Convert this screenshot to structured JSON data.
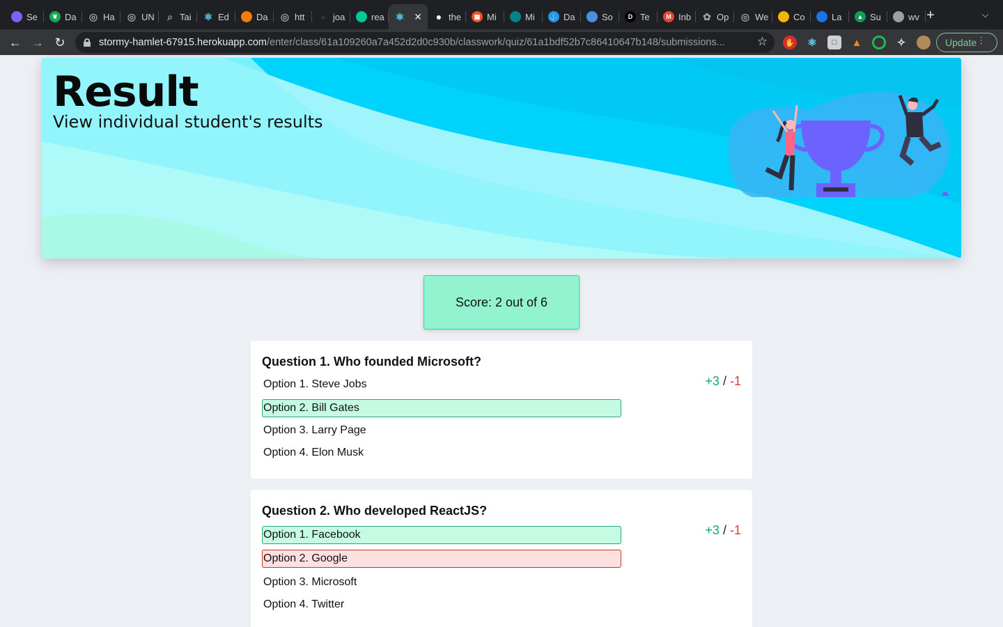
{
  "browser": {
    "tabs": [
      {
        "label": "Se",
        "icon": "circle-app-icon",
        "color": "#7b61ff"
      },
      {
        "label": "Da",
        "icon": "leaf-icon",
        "color": "#13aa52"
      },
      {
        "label": "Ha",
        "icon": "globe-icon",
        "color": "#9aa0a6"
      },
      {
        "label": "UN",
        "icon": "globe-icon",
        "color": "#9aa0a6"
      },
      {
        "label": "Tai",
        "icon": "search-icon",
        "color": "#9aa0a6"
      },
      {
        "label": "Ed",
        "icon": "react-icon",
        "color": "#61dafb"
      },
      {
        "label": "Da",
        "icon": "bracket-icon",
        "color": "#f57c00"
      },
      {
        "label": "htt",
        "icon": "globe-icon",
        "color": "#9aa0a6"
      },
      {
        "label": "joa",
        "icon": "github-icon",
        "color": "#333333"
      },
      {
        "label": "rea",
        "icon": "square-app-icon",
        "color": "#00c896"
      },
      {
        "label": "",
        "icon": "react-icon",
        "color": "#61dafb",
        "active": true
      },
      {
        "label": "the",
        "icon": "github-icon",
        "color": "#ffffff"
      },
      {
        "label": "Mi",
        "icon": "microsoft-icon",
        "color": "#f25022"
      },
      {
        "label": "Mi",
        "icon": "forms-icon",
        "color": "#038387"
      },
      {
        "label": "Da",
        "icon": "docker-icon",
        "color": "#2496ed"
      },
      {
        "label": "So",
        "icon": "arc-icon",
        "color": "#4a90e2"
      },
      {
        "label": "Te",
        "icon": "dev-icon",
        "color": "#000000"
      },
      {
        "label": "Inb",
        "icon": "gmail-icon",
        "color": "#ea4335"
      },
      {
        "label": "Op",
        "icon": "openai-icon",
        "color": "#9aa0a6"
      },
      {
        "label": "We",
        "icon": "globe-icon",
        "color": "#9aa0a6"
      },
      {
        "label": "Co",
        "icon": "classroom-icon",
        "color": "#f4b400"
      },
      {
        "label": "La",
        "icon": "contacts-icon",
        "color": "#1a73e8"
      },
      {
        "label": "Su",
        "icon": "drive-icon",
        "color": "#0f9d58"
      },
      {
        "label": "wv",
        "icon": "page-icon",
        "color": "#9aa0a6"
      }
    ],
    "url_host": "stormy-hamlet-67915.herokuapp.com",
    "url_path": "/enter/class/61a109260a7a452d2d0c930b/classwork/quiz/61a1bdf52b7c86410647b148/submissions...",
    "update_label": "Update"
  },
  "banner": {
    "title": "Result",
    "subtitle": "View individual student's results"
  },
  "score": {
    "text": "Score: 2 out of 6"
  },
  "questions": [
    {
      "title": "Question 1. Who founded Microsoft?",
      "plus": "+3",
      "sep": "/",
      "minus": "-1",
      "options": [
        {
          "text": "Option 1. Steve Jobs",
          "state": "none"
        },
        {
          "text": "Option 2. Bill Gates",
          "state": "correct"
        },
        {
          "text": "Option 3. Larry Page",
          "state": "none"
        },
        {
          "text": "Option 4. Elon Musk",
          "state": "none"
        }
      ]
    },
    {
      "title": "Question 2. Who developed ReactJS?",
      "plus": "+3",
      "sep": "/",
      "minus": "-1",
      "options": [
        {
          "text": "Option 1. Facebook",
          "state": "correct"
        },
        {
          "text": "Option 2. Google",
          "state": "wrong"
        },
        {
          "text": "Option 3. Microsoft",
          "state": "none"
        },
        {
          "text": "Option 4. Twitter",
          "state": "none"
        }
      ]
    }
  ]
}
